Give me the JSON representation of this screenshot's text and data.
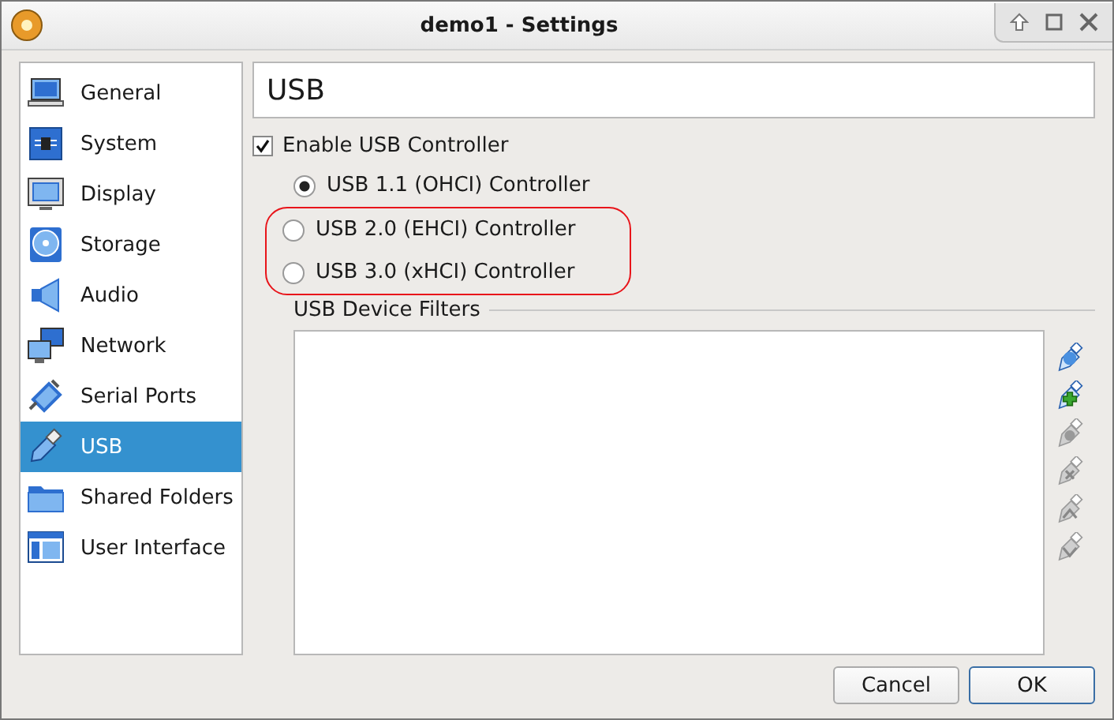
{
  "window": {
    "title": "demo1 - Settings"
  },
  "sidebar": {
    "items": [
      {
        "label": "General",
        "kind": "general",
        "selected": false
      },
      {
        "label": "System",
        "kind": "system",
        "selected": false
      },
      {
        "label": "Display",
        "kind": "display",
        "selected": false
      },
      {
        "label": "Storage",
        "kind": "storage",
        "selected": false
      },
      {
        "label": "Audio",
        "kind": "audio",
        "selected": false
      },
      {
        "label": "Network",
        "kind": "network",
        "selected": false
      },
      {
        "label": "Serial Ports",
        "kind": "serial",
        "selected": false
      },
      {
        "label": "USB",
        "kind": "usb",
        "selected": true
      },
      {
        "label": "Shared Folders",
        "kind": "folder",
        "selected": false
      },
      {
        "label": "User Interface",
        "kind": "ui",
        "selected": false
      }
    ]
  },
  "page_title": "USB",
  "enable_controller": {
    "label": "Enable USB Controller",
    "checked": true
  },
  "controllers": [
    {
      "label": "USB 1.1 (OHCI) Controller",
      "selected": true,
      "highlighted": false
    },
    {
      "label": "USB 2.0 (EHCI) Controller",
      "selected": false,
      "highlighted": true
    },
    {
      "label": "USB 3.0 (xHCI) Controller",
      "selected": false,
      "highlighted": true
    }
  ],
  "filters": {
    "title": "USB Device Filters",
    "tools": [
      {
        "kind": "add",
        "disabled": false
      },
      {
        "kind": "add-from-device",
        "disabled": false
      },
      {
        "kind": "edit",
        "disabled": true
      },
      {
        "kind": "remove",
        "disabled": true
      },
      {
        "kind": "move-up",
        "disabled": true
      },
      {
        "kind": "move-down",
        "disabled": true
      }
    ]
  },
  "buttons": [
    {
      "label": "Cancel",
      "default": false
    },
    {
      "label": "OK",
      "default": true
    }
  ]
}
